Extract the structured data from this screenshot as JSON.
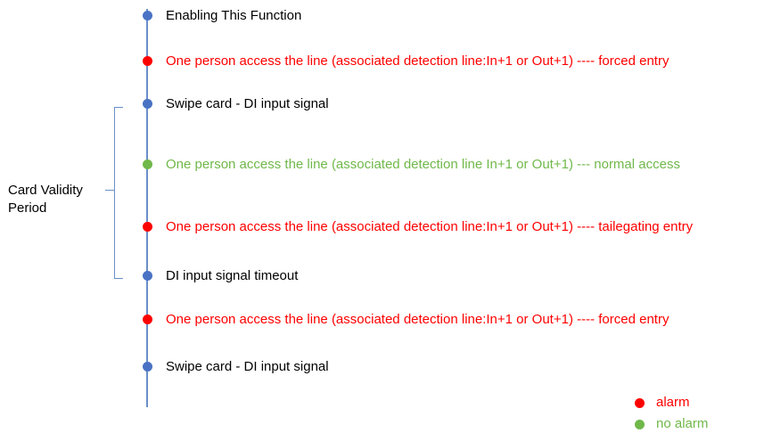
{
  "colors": {
    "neutral_dot": "#4a72c4",
    "alarm": "#ff0000",
    "no_alarm": "#70b84a",
    "neutral_text": "#000000"
  },
  "events": [
    {
      "text": "Enabling This Function",
      "type": "neutral"
    },
    {
      "text": "One person access the line (associated detection line:In+1 or Out+1) ----  forced entry",
      "type": "alarm"
    },
    {
      "text": "Swipe card - DI  input signal",
      "type": "neutral"
    },
    {
      "text": "One person access the line (associated detection line In+1 or Out+1) --- normal access",
      "type": "no_alarm"
    },
    {
      "text": "One person access the line (associated detection line:In+1 or Out+1) ----  tailegating entry",
      "type": "alarm"
    },
    {
      "text": "DI  input signal timeout",
      "type": "neutral"
    },
    {
      "text": "One person access the line (associated detection line:In+1 or Out+1) ----  forced entry",
      "type": "alarm"
    },
    {
      "text": "Swipe card - DI  input signal",
      "type": "neutral"
    }
  ],
  "bracket_label": {
    "line1": "Card Validity",
    "line2": "Period"
  },
  "legend": {
    "alarm": "alarm",
    "no_alarm": "no alarm"
  }
}
